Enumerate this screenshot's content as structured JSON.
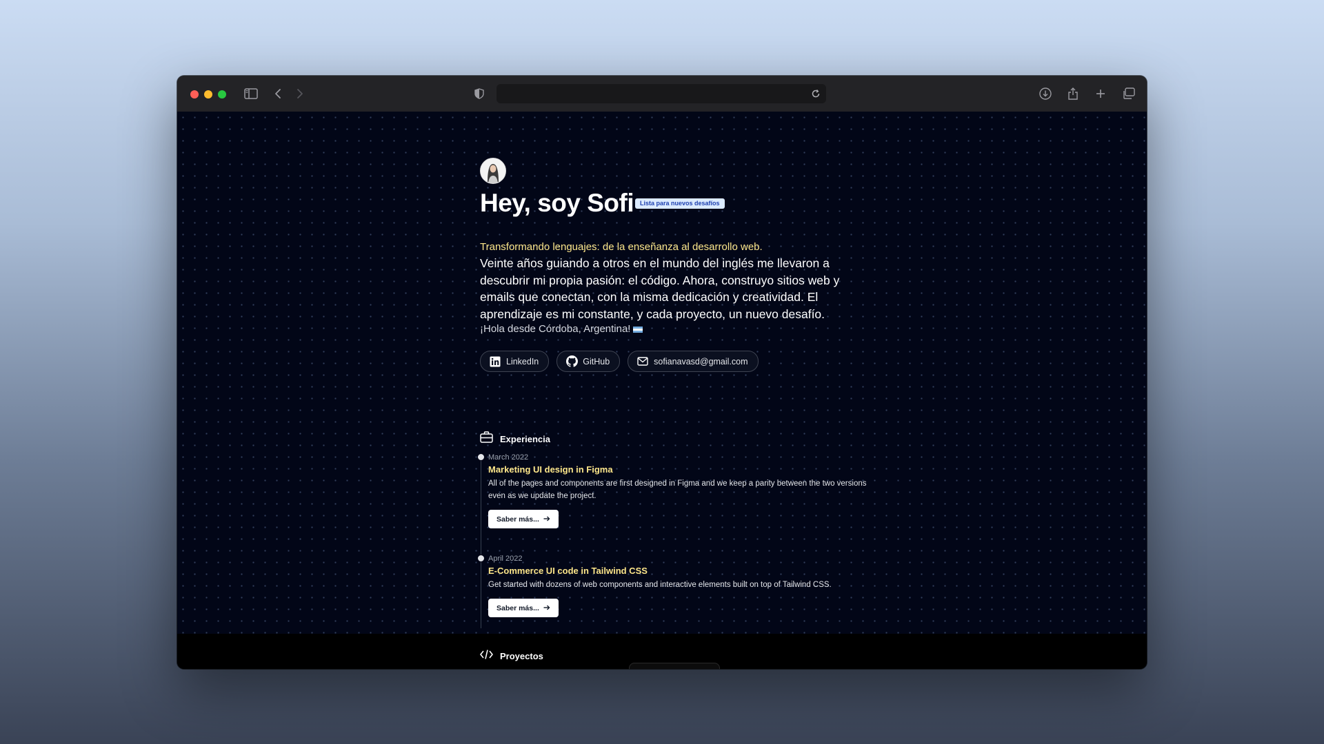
{
  "browser": {
    "address_value": "",
    "icons": [
      "sidebar-icon",
      "back-icon",
      "forward-icon",
      "privacy-shield-icon",
      "reload-icon",
      "download-icon",
      "share-icon",
      "new-tab-icon",
      "tab-overview-icon"
    ]
  },
  "hero": {
    "title": "Hey, soy Sofi",
    "badge": "Lista para nuevos desafíos",
    "tagline": "Transformando lenguajes: de la enseñanza al desarrollo web.",
    "bio": "Veinte años guiando a otros en el mundo del inglés me llevaron a descubrir mi propia pasión: el código. Ahora, construyo sitios web y emails que conectan, con la misma dedicación y creatividad. El aprendizaje es mi constante, y cada proyecto, un nuevo desafío.",
    "greeting": "¡Hola desde Córdoba, Argentina!"
  },
  "links": {
    "linkedin": "LinkedIn",
    "github": "GitHub",
    "email": "sofianavasd@gmail.com"
  },
  "experience": {
    "heading": "Experiencia",
    "items": [
      {
        "date": "March 2022",
        "title": "Marketing UI design in Figma",
        "description": "All of the pages and components are first designed in Figma and we keep a parity between the two versions even as we update the project.",
        "button": "Saber más..."
      },
      {
        "date": "April 2022",
        "title": "E-Commerce UI code in Tailwind CSS",
        "description": "Get started with dozens of web components and interactive elements built on top of Tailwind CSS.",
        "button": "Saber más..."
      }
    ]
  },
  "projects": {
    "heading": "Proyectos"
  },
  "colors": {
    "page_background": "#020617",
    "accent_yellow": "#fde68a",
    "badge_background": "#dbeafe",
    "badge_text": "#1e40af"
  }
}
